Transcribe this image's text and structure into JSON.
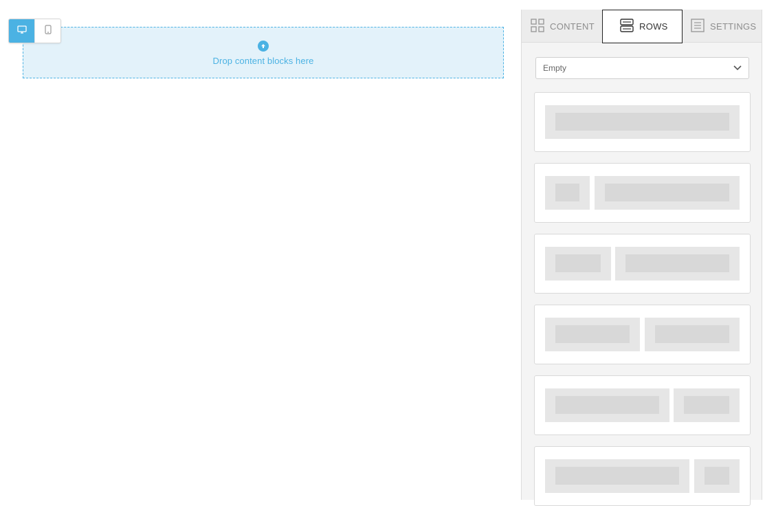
{
  "device_toggle": {
    "desktop_icon": "desktop-icon",
    "mobile_icon": "mobile-icon",
    "active": "desktop"
  },
  "dropzone": {
    "text": "Drop content blocks here",
    "icon": "arrow-up-circle-icon",
    "color": "#4bb2e3"
  },
  "tabs": [
    {
      "label": "CONTENT",
      "icon": "grid-icon",
      "active": false
    },
    {
      "label": "ROWS",
      "icon": "rows-icon",
      "active": true
    },
    {
      "label": "SETTINGS",
      "icon": "settings-list-icon",
      "active": false
    }
  ],
  "row_filter": {
    "selected": "Empty",
    "icon": "chevron-down-icon"
  },
  "row_layouts": [
    {
      "name": "1 column",
      "columns": [
        12
      ]
    },
    {
      "name": "1:3 columns",
      "columns": [
        3,
        9
      ]
    },
    {
      "name": "1:2 columns",
      "columns": [
        4,
        8
      ]
    },
    {
      "name": "2 columns",
      "columns": [
        6,
        6
      ]
    },
    {
      "name": "2:1 columns",
      "columns": [
        8,
        4
      ]
    },
    {
      "name": "3:1 columns",
      "columns": [
        9,
        3
      ]
    }
  ]
}
